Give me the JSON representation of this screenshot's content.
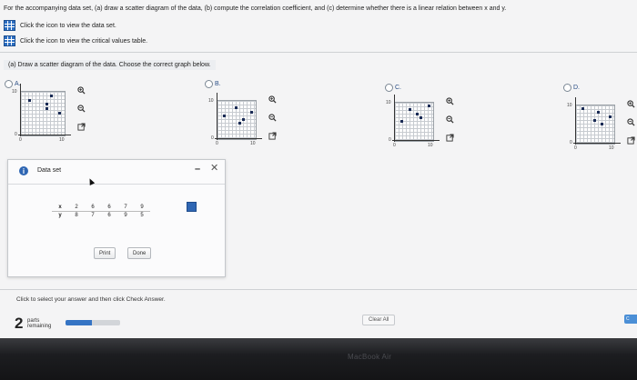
{
  "question": {
    "text": "For the accompanying data set, (a) draw a scatter diagram of the data, (b) compute the correlation coefficient, and (c) determine whether there is a linear relation between x and y.",
    "data_link": "Click the icon to view the data set.",
    "critical_link": "Click the icon to view the critical values table."
  },
  "part_a": "(a) Draw a scatter diagram of the data. Choose the correct graph below.",
  "options": [
    {
      "label": "A.",
      "ymax": "10",
      "xmin": "0",
      "xmax": "10",
      "origin": "0",
      "points": [
        [
          2,
          8
        ],
        [
          6,
          7
        ],
        [
          6,
          6
        ],
        [
          7,
          9
        ],
        [
          9,
          5
        ]
      ]
    },
    {
      "label": "B.",
      "ymax": "10",
      "xmin": "0",
      "xmax": "10",
      "origin": "0",
      "points": [
        [
          2,
          6
        ],
        [
          5,
          8
        ],
        [
          6,
          4
        ],
        [
          7,
          5
        ],
        [
          9,
          7
        ]
      ]
    },
    {
      "label": "C.",
      "ymax": "10",
      "xmin": "0",
      "xmax": "10",
      "origin": "0",
      "points": [
        [
          2,
          5
        ],
        [
          4,
          8
        ],
        [
          6,
          7
        ],
        [
          7,
          6
        ],
        [
          9,
          9
        ]
      ]
    },
    {
      "label": "D.",
      "ymax": "10",
      "xmin": "0",
      "xmax": "10",
      "origin": "0",
      "points": [
        [
          2,
          9
        ],
        [
          5,
          6
        ],
        [
          6,
          8
        ],
        [
          7,
          5
        ],
        [
          9,
          7
        ]
      ]
    }
  ],
  "icons": {
    "zoom_in": "zoom-in-icon",
    "zoom_out": "zoom-out-icon",
    "popout": "popout-icon"
  },
  "dataset": {
    "title": "Data set",
    "x_label": "x",
    "y_label": "y",
    "x": [
      "2",
      "6",
      "6",
      "7",
      "9"
    ],
    "y": [
      "8",
      "7",
      "6",
      "9",
      "5"
    ],
    "print_label": "Print",
    "done_label": "Done"
  },
  "footer": {
    "instruction": "Click to select your answer and then click Check Answer.",
    "parts_count": "2",
    "parts_label_1": "parts",
    "parts_label_2": "remaining",
    "progress": 0.48,
    "clear_all": "Clear All",
    "check_answer": "C"
  },
  "device_label": "MacBook Air",
  "colors": {
    "accent": "#2f66b3",
    "point": "#1a2b55",
    "progress": "#3574c4"
  }
}
